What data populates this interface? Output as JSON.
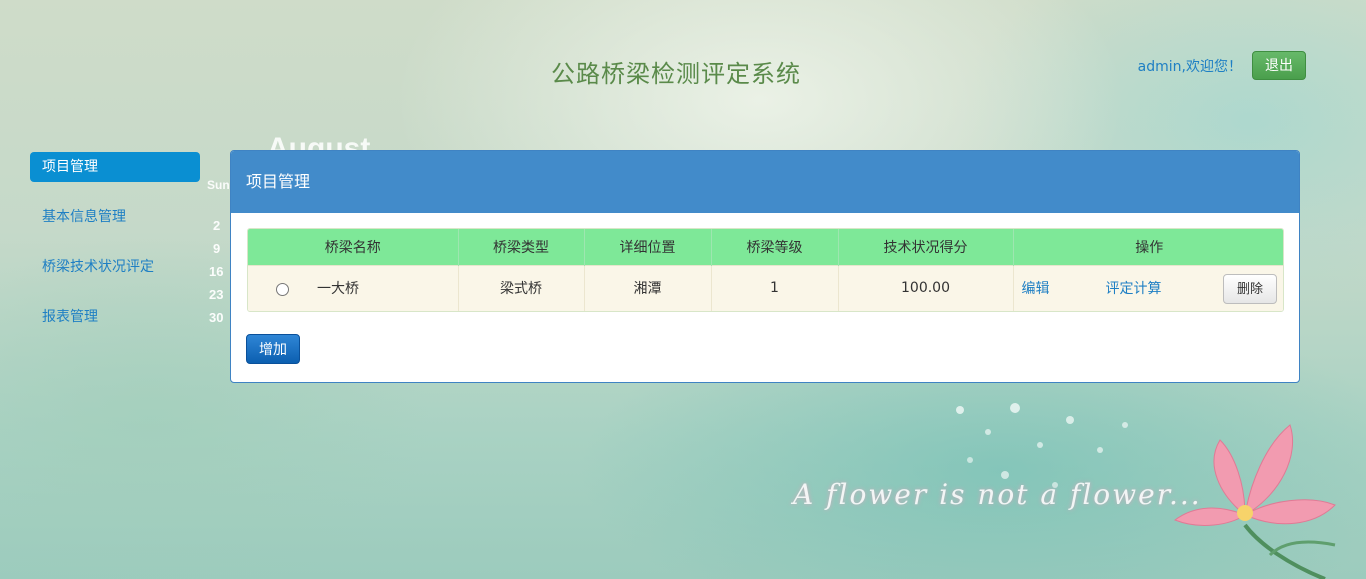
{
  "header": {
    "title": "公路桥梁检测评定系统",
    "welcome": "admin,欢迎您！",
    "logout_label": "退出"
  },
  "sidebar": {
    "items": [
      {
        "label": "项目管理",
        "active": true
      },
      {
        "label": "基本信息管理",
        "active": false
      },
      {
        "label": "桥梁技术状况评定",
        "active": false
      },
      {
        "label": "报表管理",
        "active": false
      }
    ]
  },
  "background": {
    "calendar_month": "August",
    "calendar_day_header": "Sun",
    "calendar_days": [
      "2",
      "9",
      "16",
      "23",
      "30"
    ],
    "tagline": "A flower is not a flower..."
  },
  "panel": {
    "title": "项目管理",
    "columns": [
      "桥梁名称",
      "桥梁类型",
      "详细位置",
      "桥梁等级",
      "技术状况得分",
      "操作"
    ],
    "rows": [
      {
        "name": "一大桥",
        "type": "梁式桥",
        "location": "湘潭",
        "grade": "1",
        "score": "100.00",
        "edit_label": "编辑",
        "evaluate_label": "评定计算",
        "delete_label": "删除"
      }
    ],
    "add_label": "增加"
  },
  "colors": {
    "panel_header": "#428bca",
    "table_header": "#7ee898",
    "row_bg": "#faf6e8",
    "active_nav": "#0a8fd2",
    "link": "#1e7fc4",
    "logout_button": "#4a9f4c",
    "add_button": "#0c5fb0"
  }
}
